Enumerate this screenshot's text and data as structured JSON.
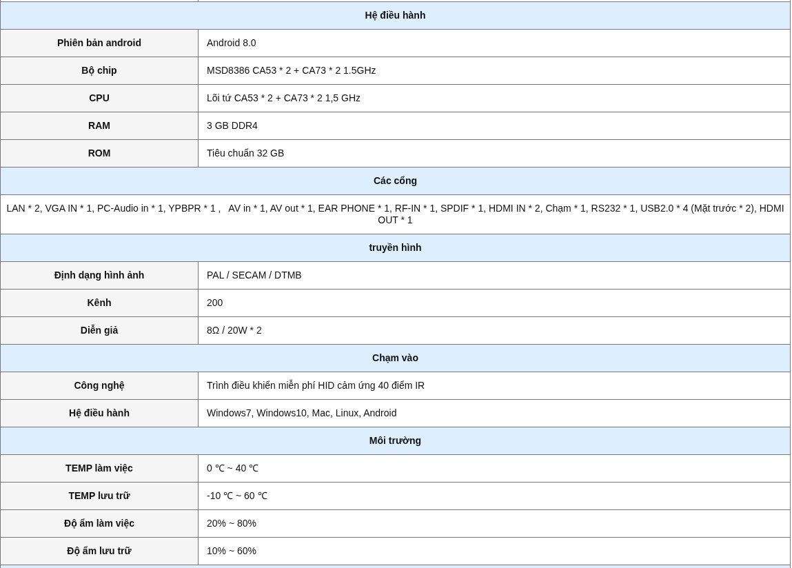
{
  "rows": [
    {
      "kind": "section",
      "text": "Hệ điều hành"
    },
    {
      "kind": "pair",
      "label": "Phiên bản android",
      "value": "Android 8.0"
    },
    {
      "kind": "pair",
      "label": "Bộ chip",
      "value": "MSD8386 CA53 * 2 + CA73 * 2 1.5GHz"
    },
    {
      "kind": "pair",
      "label": "CPU",
      "value": "Lõi tứ CA53 * 2 + CA73 * 2 1,5 GHz"
    },
    {
      "kind": "pair",
      "label": "RAM",
      "value": "3 GB DDR4"
    },
    {
      "kind": "pair",
      "label": "ROM",
      "value": "Tiêu chuẩn 32 GB"
    },
    {
      "kind": "section",
      "text": "Các cổng"
    },
    {
      "kind": "wide",
      "text": "LAN * 2, VGA IN * 1, PC-Audio in * 1, YPBPR * 1 ,   AV in * 1, AV out * 1, EAR PHONE * 1, RF-IN * 1, SPDIF * 1, HDMI IN * 2, Chạm * 1, RS232 * 1, USB2.0 * 4 (Mặt trước * 2), HDMI OUT * 1"
    },
    {
      "kind": "section",
      "text": "truyền hình"
    },
    {
      "kind": "pair",
      "label": "Định dạng hình ảnh",
      "value": "PAL / SECAM / DTMB"
    },
    {
      "kind": "pair",
      "label": "Kênh",
      "value": "200"
    },
    {
      "kind": "pair",
      "label": "Diễn giả",
      "value": "8Ω / 20W * 2"
    },
    {
      "kind": "section",
      "text": "Chạm vào"
    },
    {
      "kind": "pair",
      "label": "Công nghệ",
      "value": "Trình điều khiển miễn phí HID cảm ứng 40 điểm IR"
    },
    {
      "kind": "pair",
      "label": "Hệ điều hành",
      "value": "Windows7, Windows10, Mac, Linux, Android"
    },
    {
      "kind": "section",
      "text": "Môi trường"
    },
    {
      "kind": "pair",
      "label": "TEMP làm việc",
      "value": "0 ℃ ~ 40 ℃"
    },
    {
      "kind": "pair",
      "label": "TEMP lưu trữ",
      "value": "-10 ℃ ~ 60 ℃"
    },
    {
      "kind": "pair",
      "label": "Độ ẩm làm việc",
      "value": "20% ~ 80%"
    },
    {
      "kind": "pair",
      "label": "Độ ẩm lưu trữ",
      "value": "10% ~ 60%"
    }
  ]
}
